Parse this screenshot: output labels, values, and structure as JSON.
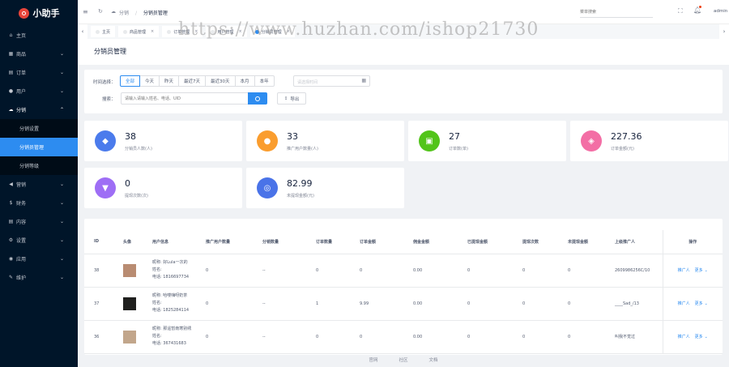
{
  "app": {
    "logo_text": "小助手"
  },
  "sidebar": {
    "items": [
      {
        "label": "主页",
        "icon": "home-icon",
        "glyph": "⌂",
        "arrow": ""
      },
      {
        "label": "商品",
        "icon": "box-icon",
        "glyph": "▦",
        "arrow": "⌄"
      },
      {
        "label": "订单",
        "icon": "order-icon",
        "glyph": "▤",
        "arrow": "⌄"
      },
      {
        "label": "用户",
        "icon": "user-icon",
        "glyph": "●",
        "arrow": "⌄"
      },
      {
        "label": "分销",
        "icon": "share-icon",
        "glyph": "☁",
        "arrow": "⌃"
      }
    ],
    "sub_items": [
      {
        "label": "分销设置"
      },
      {
        "label": "分销员管理"
      },
      {
        "label": "分销等级"
      }
    ],
    "items_after": [
      {
        "label": "营销",
        "icon": "marketing-icon",
        "glyph": "◀",
        "arrow": "⌄"
      },
      {
        "label": "财务",
        "icon": "finance-icon",
        "glyph": "$",
        "arrow": "⌄"
      },
      {
        "label": "内容",
        "icon": "content-icon",
        "glyph": "▤",
        "arrow": "⌄"
      },
      {
        "label": "设置",
        "icon": "settings-icon",
        "glyph": "⚙",
        "arrow": "⌄"
      },
      {
        "label": "应用",
        "icon": "apps-icon",
        "glyph": "◉",
        "arrow": "⌄"
      },
      {
        "label": "维护",
        "icon": "wrench-icon",
        "glyph": "✎",
        "arrow": "⌄"
      }
    ]
  },
  "header": {
    "breadcrumb": [
      "分销",
      "分销员管理"
    ],
    "search_placeholder": "菜单搜索",
    "user": "admin"
  },
  "tabs": {
    "items": [
      {
        "label": "主页"
      },
      {
        "label": "商品管理"
      },
      {
        "label": "订单管理"
      },
      {
        "label": "用户管理"
      },
      {
        "label": "分销员管理"
      }
    ]
  },
  "page": {
    "title": "分销员管理"
  },
  "filters": {
    "time_label": "时间选择：",
    "time_options": [
      "全部",
      "今天",
      "昨天",
      "最近7天",
      "最近30天",
      "本月",
      "本年"
    ],
    "date_placeholder": "请选择时间",
    "search_label": "搜索：",
    "search_placeholder": "请输入请输入姓名、电话、UID",
    "export_label": "导出"
  },
  "stats": [
    {
      "value": "38",
      "label": "分销员人数(人)",
      "color": "#4b7bec",
      "icon": "users-icon",
      "glyph": "◆"
    },
    {
      "value": "33",
      "label": "推广用户数量(人)",
      "color": "#fa9d2e",
      "icon": "user-circle-icon",
      "glyph": "●"
    },
    {
      "value": "27",
      "label": "订单数(单)",
      "color": "#52c41a",
      "icon": "cart-icon",
      "glyph": "▣"
    },
    {
      "value": "227.36",
      "label": "订单金额(元)",
      "color": "#f36ea5",
      "icon": "coin-icon",
      "glyph": "◈"
    },
    {
      "value": "0",
      "label": "提现次数(次)",
      "color": "#9e6ef5",
      "icon": "basket-icon",
      "glyph": "▼"
    },
    {
      "value": "82.99",
      "label": "未提现金额(元)",
      "color": "#4a73e8",
      "icon": "wallet-icon",
      "glyph": "◎"
    }
  ],
  "table": {
    "columns": [
      "ID",
      "头像",
      "用户信息",
      "推广用户数量",
      "分销数量",
      "订单数量",
      "订单金额",
      "佣金金额",
      "已提现金额",
      "提现次数",
      "未提现金额",
      "上级推广人",
      "操作"
    ],
    "rows": [
      {
        "id": "38",
        "nick": "昵称: 好Lula一次的",
        "name": "姓名:",
        "phone": "电话: 1816697734",
        "promo": "0",
        "dist": "--",
        "orders": "0",
        "amount": "0",
        "commission": "0.00",
        "withdrawn": "0",
        "wcount": "0",
        "unwithdrawn": "0",
        "superior": "2609986256C/10",
        "avatar_color": "#b98c72"
      },
      {
        "id": "37",
        "nick": "昵称: 哈喽嗨呀奶茶",
        "name": "姓名:",
        "phone": "电话: 1825284114",
        "promo": "0",
        "dist": "--",
        "orders": "1",
        "amount": "9.99",
        "commission": "0.00",
        "withdrawn": "0",
        "wcount": "0",
        "unwithdrawn": "0",
        "superior": "____Sad_/13",
        "avatar_color": "#20201e"
      },
      {
        "id": "36",
        "nick": "昵称: 那遥暂南寒别绣",
        "name": "姓名:",
        "phone": "电话: 367431683",
        "promo": "0",
        "dist": "--",
        "orders": "0",
        "amount": "0",
        "commission": "0.00",
        "withdrawn": "0",
        "wcount": "0",
        "unwithdrawn": "0",
        "superior": "叫我不觉过",
        "avatar_color": "#c2a68b"
      }
    ],
    "action_promote": "推广人",
    "action_more": "更多"
  },
  "footer": {
    "links": [
      "官网",
      "社区",
      "文档"
    ]
  },
  "watermark": "https://www.huzhan.com/ishop21730"
}
